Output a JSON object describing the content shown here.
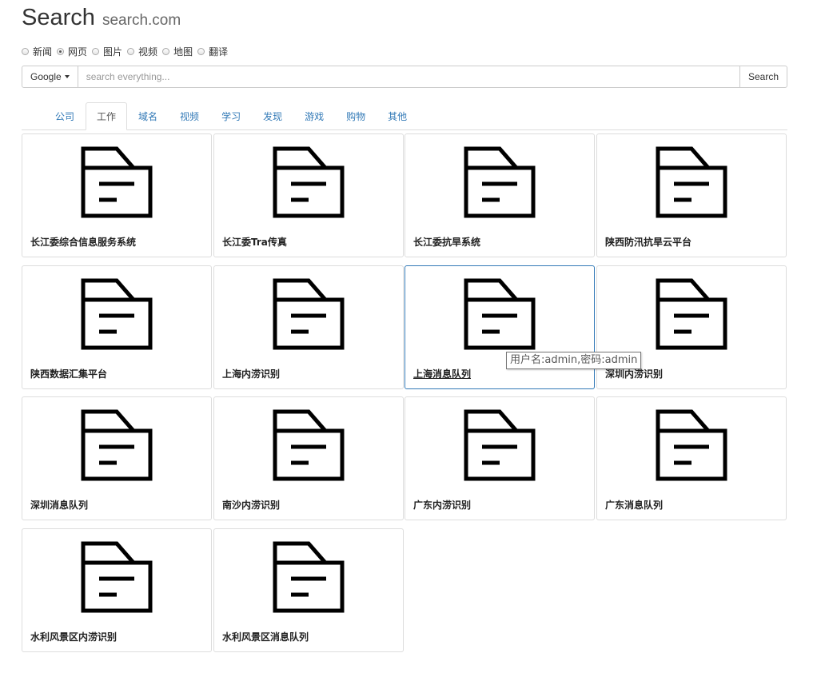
{
  "header": {
    "title": "Search",
    "domain": "search.com"
  },
  "category_options": [
    {
      "label": "新闻",
      "checked": false
    },
    {
      "label": "网页",
      "checked": true
    },
    {
      "label": "图片",
      "checked": false
    },
    {
      "label": "视频",
      "checked": false
    },
    {
      "label": "地图",
      "checked": false
    },
    {
      "label": "翻译",
      "checked": false
    }
  ],
  "search": {
    "engine": "Google",
    "placeholder": "search everything...",
    "value": "",
    "button_label": "Search"
  },
  "tabs": [
    {
      "label": "公司",
      "active": false
    },
    {
      "label": "工作",
      "active": true
    },
    {
      "label": "域名",
      "active": false
    },
    {
      "label": "视频",
      "active": false
    },
    {
      "label": "学习",
      "active": false
    },
    {
      "label": "发现",
      "active": false
    },
    {
      "label": "游戏",
      "active": false
    },
    {
      "label": "购物",
      "active": false
    },
    {
      "label": "其他",
      "active": false
    }
  ],
  "cards": [
    {
      "label": "长江委综合信息服务系统",
      "icon": "folder-icon"
    },
    {
      "label": "长江委Tra传真",
      "icon": "folder-icon"
    },
    {
      "label": "长江委抗旱系统",
      "icon": "folder-icon"
    },
    {
      "label": "陕西防汛抗旱云平台",
      "icon": "folder-icon"
    },
    {
      "label": "陕西数据汇集平台",
      "icon": "folder-icon"
    },
    {
      "label": "上海内涝识别",
      "icon": "folder-icon"
    },
    {
      "label": "上海消息队列",
      "icon": "folder-icon",
      "hovered": true
    },
    {
      "label": "深圳内涝识别",
      "icon": "folder-icon"
    },
    {
      "label": "深圳消息队列",
      "icon": "folder-icon"
    },
    {
      "label": "南沙内涝识别",
      "icon": "folder-icon"
    },
    {
      "label": "广东内涝识别",
      "icon": "folder-icon"
    },
    {
      "label": "广东消息队列",
      "icon": "folder-icon"
    },
    {
      "label": "水利风景区内涝识别",
      "icon": "folder-icon"
    },
    {
      "label": "水利风景区消息队列",
      "icon": "folder-icon"
    }
  ],
  "tooltip": {
    "text": "用户名:admin,密码:admin"
  },
  "colors": {
    "link": "#337ab7",
    "border": "#dddddd",
    "icon": "#000000"
  }
}
